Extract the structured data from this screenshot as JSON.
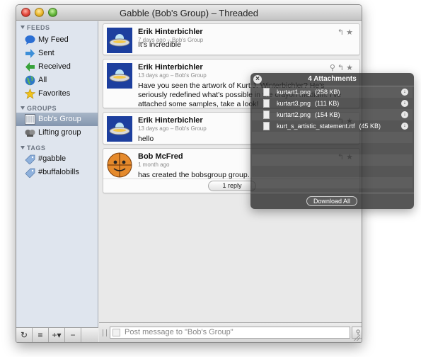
{
  "window": {
    "title": "Gabble (Bob's Group) – Threaded"
  },
  "sidebar": {
    "feeds_header": "FEEDS",
    "feeds": [
      {
        "label": "My Feed",
        "icon": "speech-bubble-icon"
      },
      {
        "label": "Sent",
        "icon": "arrow-right-icon"
      },
      {
        "label": "Received",
        "icon": "arrow-left-icon"
      },
      {
        "label": "All",
        "icon": "globe-icon"
      },
      {
        "label": "Favorites",
        "icon": "star-icon"
      }
    ],
    "groups_header": "GROUPS",
    "groups": [
      {
        "label": "Bob's Group",
        "icon": "group-icon",
        "selected": true
      },
      {
        "label": "Lifting group",
        "icon": "group-icon",
        "selected": false
      }
    ],
    "tags_header": "TAGS",
    "tags": [
      {
        "label": "#gabble",
        "icon": "tag-icon"
      },
      {
        "label": "#buffalobills",
        "icon": "tag-icon"
      }
    ],
    "bottom_buttons": [
      "↻",
      "≡",
      "+▾",
      "−"
    ]
  },
  "messages": [
    {
      "author": "Erik Hinterbichler",
      "meta": "7 days ago – Bob's Group",
      "body": "It's incredible",
      "avatar": "ufo-avatar"
    },
    {
      "author": "Erik Hinterbichler",
      "meta": "13 days ago – Bob's Group",
      "body": "Have you seen the artwork of Kurt J. Winterbichler? He's seriously redefined what's possible in the crayon medium. I've attached some samples, take a look!",
      "avatar": "ufo-avatar"
    },
    {
      "author": "Erik Hinterbichler",
      "meta": "13 days ago – Bob's Group",
      "body": "hello",
      "avatar": "ufo-avatar"
    },
    {
      "author": "Bob McFred",
      "meta": "1 month ago",
      "body": "has created the bobsgroup group.",
      "avatar": "basketball-avatar"
    }
  ],
  "reply_button": "1 reply",
  "composer": {
    "placeholder": "Post message to \"Bob's Group\""
  },
  "attachments": {
    "title": "4 Attachments",
    "files": [
      {
        "name": "kurtart1.png",
        "size": "(258 KB)"
      },
      {
        "name": "kurtart3.png",
        "size": "(111 KB)"
      },
      {
        "name": "kurtart2.png",
        "size": "(154 KB)"
      },
      {
        "name": "kurt_s_artistic_statement.rtf",
        "size": "(45 KB)"
      }
    ],
    "download_all": "Download All"
  },
  "colors": {
    "sidebar_bg": "#dfe5ee",
    "selection": "#8496ae",
    "hud_bg": "#262626"
  }
}
